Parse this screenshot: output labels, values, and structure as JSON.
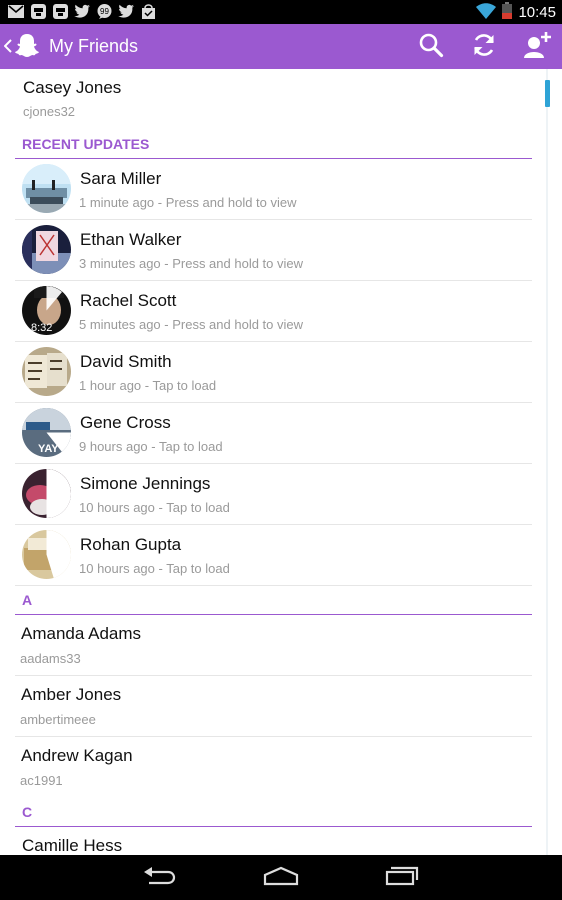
{
  "status_bar": {
    "time": "10:45",
    "icons": [
      "gmail-icon",
      "app-icon",
      "app-icon",
      "twitter-icon",
      "chat-icon",
      "twitter-icon",
      "bag-icon",
      "wifi-icon",
      "battery-icon"
    ]
  },
  "header": {
    "title": "My Friends",
    "accent": "#9b59d0"
  },
  "me": {
    "name": "Casey Jones",
    "username": "cjones32"
  },
  "sections": {
    "recent": "RECENT UPDATES",
    "a": "A",
    "c": "C"
  },
  "recent_updates": [
    {
      "name": "Sara Miller",
      "status": "1 minute ago - Press and hold to view"
    },
    {
      "name": "Ethan Walker",
      "status": "3 minutes ago - Press and hold to view"
    },
    {
      "name": "Rachel Scott",
      "status": "5 minutes ago - Press and hold to view"
    },
    {
      "name": "David Smith",
      "status": "1 hour ago - Tap to load"
    },
    {
      "name": "Gene Cross",
      "status": "9 hours ago - Tap to load"
    },
    {
      "name": "Simone Jennings",
      "status": "10 hours ago - Tap to load"
    },
    {
      "name": "Rohan Gupta",
      "status": "10 hours ago - Tap to load"
    }
  ],
  "friends_a": [
    {
      "name": "Amanda Adams",
      "username": "aadams33"
    },
    {
      "name": "Amber Jones",
      "username": "ambertimeee"
    },
    {
      "name": "Andrew Kagan",
      "username": "ac1991"
    }
  ],
  "friends_c": [
    {
      "name": "Camille Hess"
    }
  ],
  "avatar_texts": {
    "rachel": "8:32",
    "gene": "YAY"
  }
}
